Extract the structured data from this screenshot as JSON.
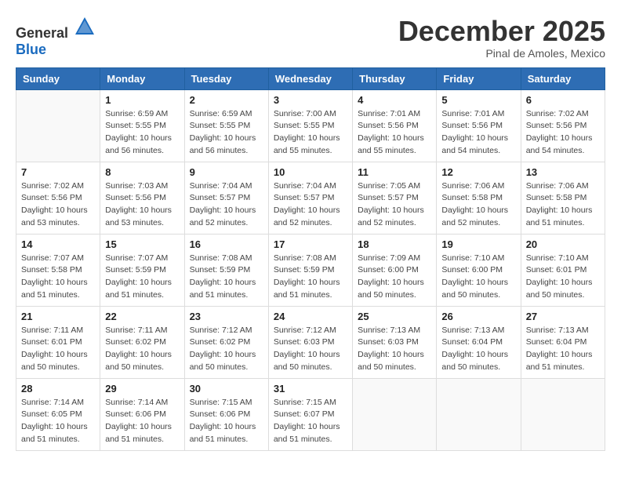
{
  "header": {
    "logo_general": "General",
    "logo_blue": "Blue",
    "month": "December 2025",
    "location": "Pinal de Amoles, Mexico"
  },
  "weekdays": [
    "Sunday",
    "Monday",
    "Tuesday",
    "Wednesday",
    "Thursday",
    "Friday",
    "Saturday"
  ],
  "weeks": [
    [
      {
        "day": "",
        "info": ""
      },
      {
        "day": "1",
        "info": "Sunrise: 6:59 AM\nSunset: 5:55 PM\nDaylight: 10 hours\nand 56 minutes."
      },
      {
        "day": "2",
        "info": "Sunrise: 6:59 AM\nSunset: 5:55 PM\nDaylight: 10 hours\nand 56 minutes."
      },
      {
        "day": "3",
        "info": "Sunrise: 7:00 AM\nSunset: 5:55 PM\nDaylight: 10 hours\nand 55 minutes."
      },
      {
        "day": "4",
        "info": "Sunrise: 7:01 AM\nSunset: 5:56 PM\nDaylight: 10 hours\nand 55 minutes."
      },
      {
        "day": "5",
        "info": "Sunrise: 7:01 AM\nSunset: 5:56 PM\nDaylight: 10 hours\nand 54 minutes."
      },
      {
        "day": "6",
        "info": "Sunrise: 7:02 AM\nSunset: 5:56 PM\nDaylight: 10 hours\nand 54 minutes."
      }
    ],
    [
      {
        "day": "7",
        "info": "Sunrise: 7:02 AM\nSunset: 5:56 PM\nDaylight: 10 hours\nand 53 minutes."
      },
      {
        "day": "8",
        "info": "Sunrise: 7:03 AM\nSunset: 5:56 PM\nDaylight: 10 hours\nand 53 minutes."
      },
      {
        "day": "9",
        "info": "Sunrise: 7:04 AM\nSunset: 5:57 PM\nDaylight: 10 hours\nand 52 minutes."
      },
      {
        "day": "10",
        "info": "Sunrise: 7:04 AM\nSunset: 5:57 PM\nDaylight: 10 hours\nand 52 minutes."
      },
      {
        "day": "11",
        "info": "Sunrise: 7:05 AM\nSunset: 5:57 PM\nDaylight: 10 hours\nand 52 minutes."
      },
      {
        "day": "12",
        "info": "Sunrise: 7:06 AM\nSunset: 5:58 PM\nDaylight: 10 hours\nand 52 minutes."
      },
      {
        "day": "13",
        "info": "Sunrise: 7:06 AM\nSunset: 5:58 PM\nDaylight: 10 hours\nand 51 minutes."
      }
    ],
    [
      {
        "day": "14",
        "info": "Sunrise: 7:07 AM\nSunset: 5:58 PM\nDaylight: 10 hours\nand 51 minutes."
      },
      {
        "day": "15",
        "info": "Sunrise: 7:07 AM\nSunset: 5:59 PM\nDaylight: 10 hours\nand 51 minutes."
      },
      {
        "day": "16",
        "info": "Sunrise: 7:08 AM\nSunset: 5:59 PM\nDaylight: 10 hours\nand 51 minutes."
      },
      {
        "day": "17",
        "info": "Sunrise: 7:08 AM\nSunset: 5:59 PM\nDaylight: 10 hours\nand 51 minutes."
      },
      {
        "day": "18",
        "info": "Sunrise: 7:09 AM\nSunset: 6:00 PM\nDaylight: 10 hours\nand 50 minutes."
      },
      {
        "day": "19",
        "info": "Sunrise: 7:10 AM\nSunset: 6:00 PM\nDaylight: 10 hours\nand 50 minutes."
      },
      {
        "day": "20",
        "info": "Sunrise: 7:10 AM\nSunset: 6:01 PM\nDaylight: 10 hours\nand 50 minutes."
      }
    ],
    [
      {
        "day": "21",
        "info": "Sunrise: 7:11 AM\nSunset: 6:01 PM\nDaylight: 10 hours\nand 50 minutes."
      },
      {
        "day": "22",
        "info": "Sunrise: 7:11 AM\nSunset: 6:02 PM\nDaylight: 10 hours\nand 50 minutes."
      },
      {
        "day": "23",
        "info": "Sunrise: 7:12 AM\nSunset: 6:02 PM\nDaylight: 10 hours\nand 50 minutes."
      },
      {
        "day": "24",
        "info": "Sunrise: 7:12 AM\nSunset: 6:03 PM\nDaylight: 10 hours\nand 50 minutes."
      },
      {
        "day": "25",
        "info": "Sunrise: 7:13 AM\nSunset: 6:03 PM\nDaylight: 10 hours\nand 50 minutes."
      },
      {
        "day": "26",
        "info": "Sunrise: 7:13 AM\nSunset: 6:04 PM\nDaylight: 10 hours\nand 50 minutes."
      },
      {
        "day": "27",
        "info": "Sunrise: 7:13 AM\nSunset: 6:04 PM\nDaylight: 10 hours\nand 51 minutes."
      }
    ],
    [
      {
        "day": "28",
        "info": "Sunrise: 7:14 AM\nSunset: 6:05 PM\nDaylight: 10 hours\nand 51 minutes."
      },
      {
        "day": "29",
        "info": "Sunrise: 7:14 AM\nSunset: 6:06 PM\nDaylight: 10 hours\nand 51 minutes."
      },
      {
        "day": "30",
        "info": "Sunrise: 7:15 AM\nSunset: 6:06 PM\nDaylight: 10 hours\nand 51 minutes."
      },
      {
        "day": "31",
        "info": "Sunrise: 7:15 AM\nSunset: 6:07 PM\nDaylight: 10 hours\nand 51 minutes."
      },
      {
        "day": "",
        "info": ""
      },
      {
        "day": "",
        "info": ""
      },
      {
        "day": "",
        "info": ""
      }
    ]
  ]
}
